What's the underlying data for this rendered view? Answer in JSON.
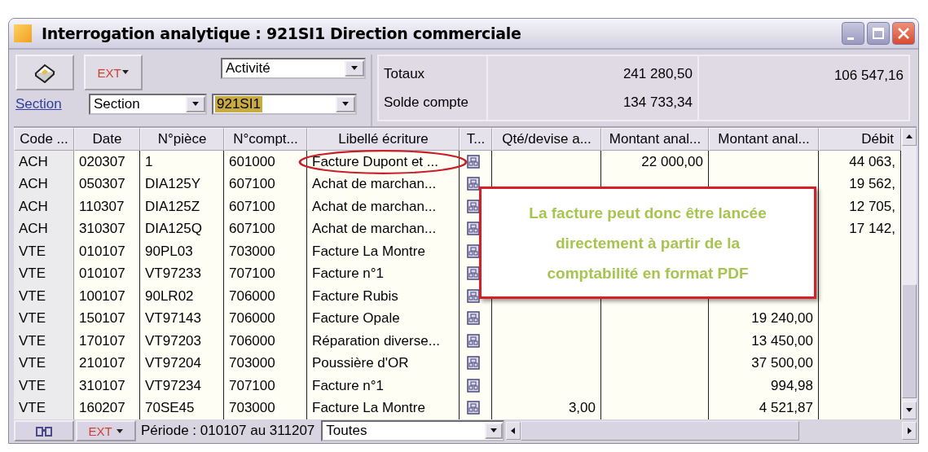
{
  "window": {
    "title": "Interrogation analytique : 921SI1 Direction commerciale"
  },
  "toolbar": {
    "ext_button": "EXT",
    "section_link": "Section",
    "section_combo": "Section",
    "activity_combo": "Activité",
    "code_combo": {
      "value": "921SI1",
      "selected": true
    }
  },
  "totals": {
    "labels": [
      "Totaux",
      "Solde compte"
    ],
    "total_1": "241 280,50",
    "total_2": "106 547,16",
    "balance": "134 733,34"
  },
  "table": {
    "columns": [
      "Code ...",
      "Date",
      "N°pièce",
      "N°compt...",
      "Libellé écriture",
      "T...",
      "Qté/devise a...",
      "Montant anal...",
      "Montant anal...",
      "Débit"
    ],
    "rows": [
      {
        "code": "ACH",
        "date": "020307",
        "piece": "1",
        "account": "601000",
        "label": "Facture Dupont et ...",
        "circled": true,
        "amount_1": "22 000,00",
        "debit": "44 063,"
      },
      {
        "code": "ACH",
        "date": "050307",
        "piece": "DIA125Y",
        "account": "607100",
        "label": "Achat de marchan...",
        "circled": false,
        "debit": "19 562,"
      },
      {
        "code": "ACH",
        "date": "110307",
        "piece": "DIA125Z",
        "account": "607100",
        "label": "Achat de marchan...",
        "circled": false,
        "debit": "12 705,"
      },
      {
        "code": "ACH",
        "date": "310307",
        "piece": "DIA125Q",
        "account": "607100",
        "label": "Achat de marchan...",
        "circled": false,
        "debit": "17 142,"
      },
      {
        "code": "VTE",
        "date": "010107",
        "piece": "90PL03",
        "account": "703000",
        "label": "Facture La Montre",
        "circled": false
      },
      {
        "code": "VTE",
        "date": "010107",
        "piece": "VT97233",
        "account": "707100",
        "label": "Facture n°1",
        "circled": false
      },
      {
        "code": "VTE",
        "date": "100107",
        "piece": "90LR02",
        "account": "706000",
        "label": "Facture Rubis",
        "circled": false
      },
      {
        "code": "VTE",
        "date": "150107",
        "piece": "VT97143",
        "account": "706000",
        "label": "Facture Opale",
        "circled": false,
        "amount_2": "19 240,00"
      },
      {
        "code": "VTE",
        "date": "170107",
        "piece": "VT97203",
        "account": "706000",
        "label": "Réparation diverse...",
        "circled": false,
        "amount_2": "13 450,00"
      },
      {
        "code": "VTE",
        "date": "210107",
        "piece": "VT97204",
        "account": "703000",
        "label": "Poussière d'OR",
        "circled": false,
        "amount_2": "37 500,00"
      },
      {
        "code": "VTE",
        "date": "310107",
        "piece": "VT97234",
        "account": "707100",
        "label": "Facture n°1",
        "circled": false,
        "amount_2": "994,98"
      },
      {
        "code": "VTE",
        "date": "160207",
        "piece": "70SE45",
        "account": "703000",
        "label": "Facture La Montre",
        "circled": false,
        "qty": "3,00",
        "amount_2": "4 521,87"
      }
    ]
  },
  "status_bar": {
    "ext_button": "EXT",
    "period": "Période : 010107 au 311207",
    "filter_combo": "Toutes"
  },
  "callout": {
    "text": "La facture peut donc être lancée directement à partir de la comptabilité en format PDF"
  }
}
